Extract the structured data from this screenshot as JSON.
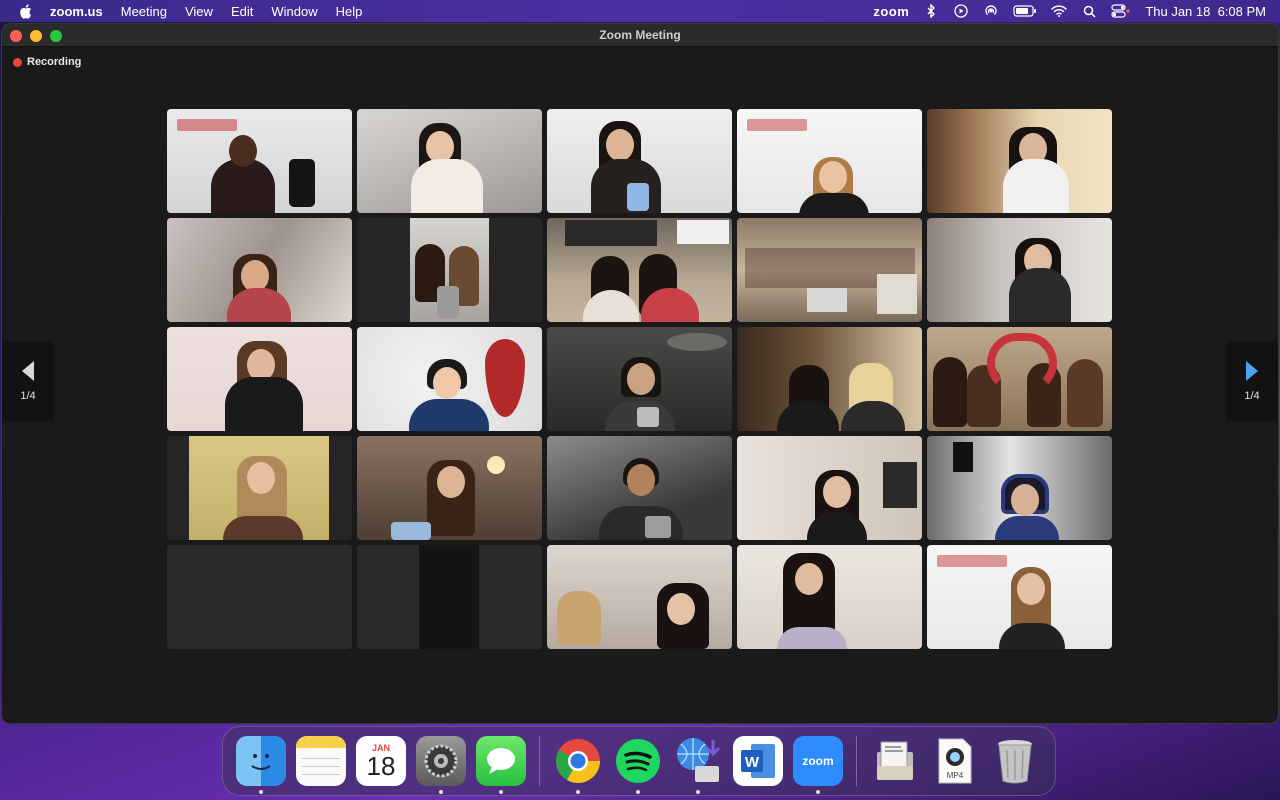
{
  "menubar": {
    "app_name": "zoom.us",
    "menus": [
      "Meeting",
      "View",
      "Edit",
      "Window",
      "Help"
    ],
    "status_app": "zoom",
    "datetime": "Thu Jan 18  6:08 PM"
  },
  "window": {
    "title": "Zoom Meeting",
    "recording_label": "Recording"
  },
  "gallery": {
    "page_indicator": "1/4",
    "tile_count": 25,
    "active_speaker_index": 0
  },
  "dock": {
    "calendar_month": "JAN",
    "calendar_day": "18",
    "zoom_label": "zoom",
    "mp4_label": "MP4",
    "apps": [
      "Finder",
      "Notes",
      "Calendar",
      "System Settings",
      "Messages",
      "Chrome",
      "Spotify",
      "Network Utility",
      "Word",
      "Zoom",
      "Preview",
      "MP4 File",
      "Trash"
    ]
  },
  "colors": {
    "active_border": "#3fcf4a",
    "recording": "#e5483f",
    "pager_arrow": "#4aa3f0"
  }
}
